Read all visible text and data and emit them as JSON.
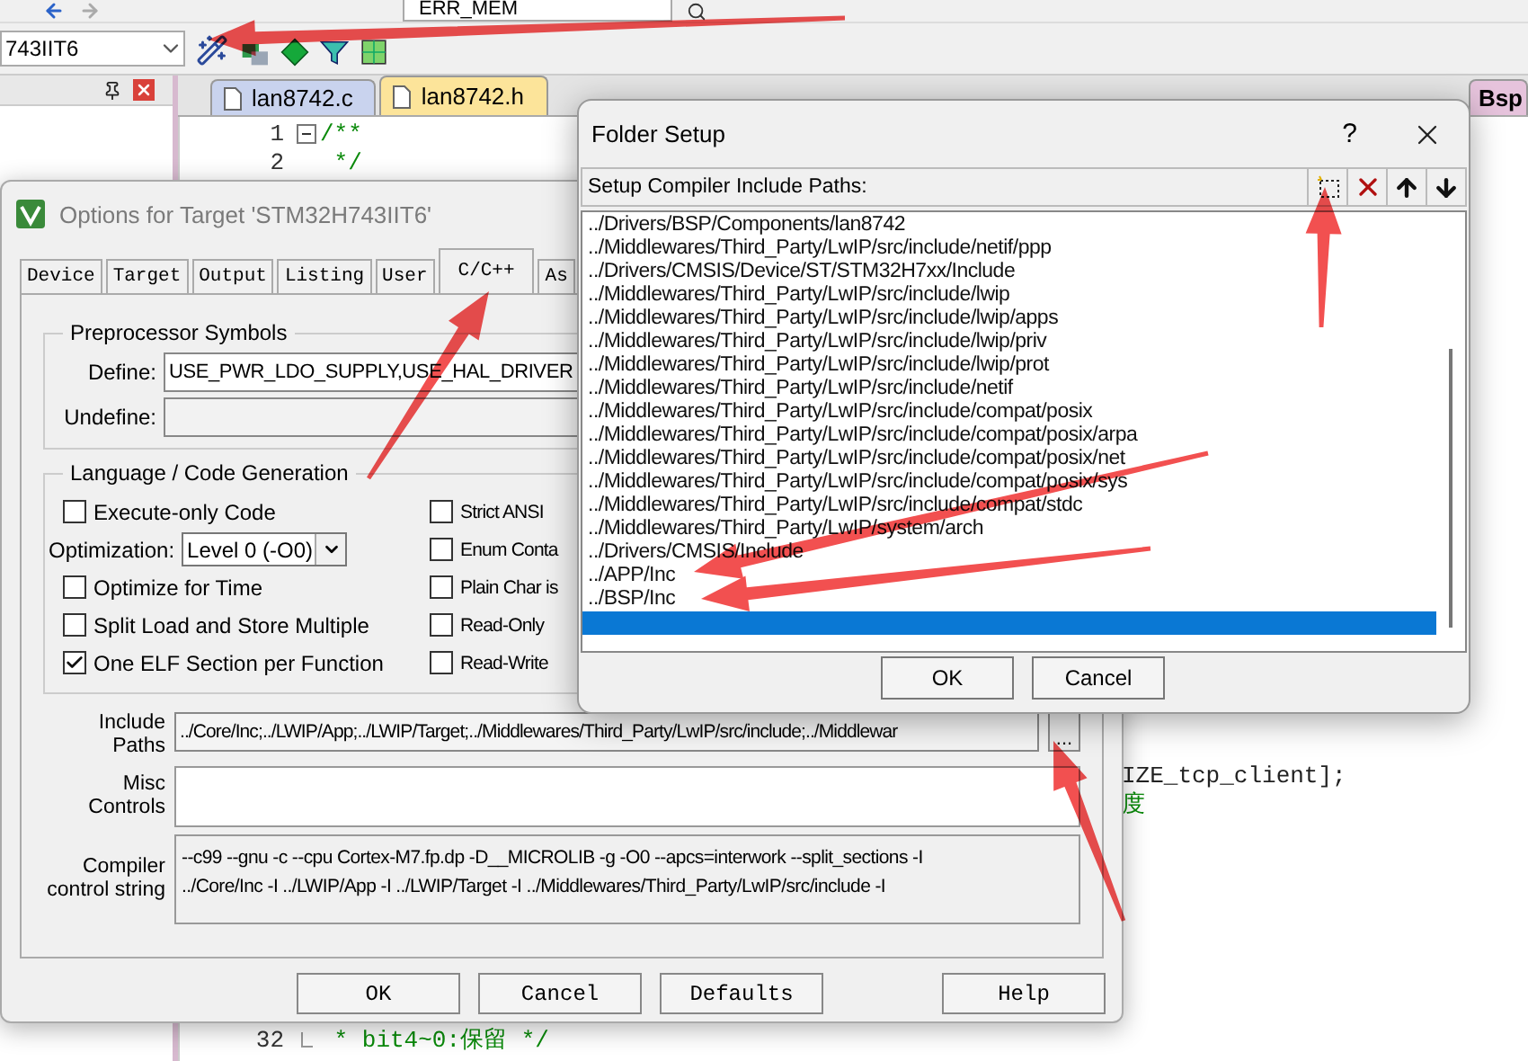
{
  "ide": {
    "find_combo": "ERR_MEM",
    "target_combo": "743IIT6",
    "editor_tabs": [
      {
        "label": "lan8742.c",
        "selected": false,
        "color": "#c9d3ee"
      },
      {
        "label": "lan8742.h",
        "selected": true,
        "color": "#fce49a"
      },
      {
        "label": "Bsp",
        "selected": false,
        "color": "#e6c3dc"
      }
    ],
    "editor_lines_top": [
      {
        "number": "1",
        "text": "/**",
        "fold_box": true,
        "kind": "comment"
      },
      {
        "number": "2",
        "text": " */",
        "kind": "comment"
      }
    ],
    "editor_fragments": [
      {
        "text": "IZE_tcp_client];",
        "kind": "code"
      },
      {
        "text": "度",
        "kind": "comment"
      }
    ],
    "editor_lines_bottom": [
      {
        "number": "32",
        "text": " * bit4~0:保留 */",
        "fold_end": true,
        "kind": "comment"
      }
    ]
  },
  "options_dialog": {
    "title": "Options for Target 'STM32H743IIT6'",
    "tabs": [
      {
        "label": "Device",
        "selected": false
      },
      {
        "label": "Target",
        "selected": false
      },
      {
        "label": "Output",
        "selected": false
      },
      {
        "label": "Listing",
        "selected": false
      },
      {
        "label": "User",
        "selected": false
      },
      {
        "label": "C/C++",
        "selected": true
      },
      {
        "label": "As",
        "selected": false
      }
    ],
    "preprocessor": {
      "title": "Preprocessor Symbols",
      "define_label": "Define:",
      "define_value": "USE_PWR_LDO_SUPPLY,USE_HAL_DRIVER",
      "undefine_label": "Undefine:"
    },
    "codegen": {
      "title": "Language / Code Generation",
      "left": [
        {
          "kind": "checkbox",
          "label": "Execute-only Code",
          "checked": false
        },
        {
          "kind": "select",
          "label": "Optimization:",
          "value": "Level 0 (-O0)"
        },
        {
          "kind": "checkbox",
          "label": "Optimize for Time",
          "checked": false
        },
        {
          "kind": "checkbox",
          "label": "Split Load and Store Multiple",
          "checked": false
        },
        {
          "kind": "checkbox",
          "label": "One ELF Section per Function",
          "checked": true
        }
      ],
      "right": [
        {
          "label": "Strict ANSI",
          "checked": false
        },
        {
          "label": "Enum Conta",
          "checked": false
        },
        {
          "label": "Plain Char is",
          "checked": false
        },
        {
          "label": "Read-Only",
          "checked": false
        },
        {
          "label": "Read-Write",
          "checked": false
        }
      ]
    },
    "include_paths": {
      "label": "Include Paths",
      "value": "../Core/Inc;../LWIP/App;../LWIP/Target;../Middlewares/Third_Party/LwIP/src/include;../Middlewar",
      "button": "..."
    },
    "misc_controls": {
      "label": "Misc Controls"
    },
    "compiler_string": {
      "label": "Compiler control string",
      "lines": [
        "--c99 --gnu -c --cpu Cortex-M7.fp.dp -D__MICROLIB -g -O0 --apcs=interwork --split_sections -I",
        "../Core/Inc -I ../LWIP/App -I ../LWIP/Target -I ../Middlewares/Third_Party/LwIP/src/include -I"
      ]
    },
    "buttons": [
      "OK",
      "Cancel",
      "Defaults",
      "Help"
    ]
  },
  "folder_dialog": {
    "title": "Folder Setup",
    "help": "?",
    "header": "Setup Compiler Include Paths:",
    "paths": [
      {
        "text": "../Drivers/BSP/Components/lan8742",
        "selected": false
      },
      {
        "text": "../Middlewares/Third_Party/LwIP/src/include/netif/ppp",
        "selected": false
      },
      {
        "text": "../Drivers/CMSIS/Device/ST/STM32H7xx/Include",
        "selected": false
      },
      {
        "text": "../Middlewares/Third_Party/LwIP/src/include/lwip",
        "selected": false
      },
      {
        "text": "../Middlewares/Third_Party/LwIP/src/include/lwip/apps",
        "selected": false
      },
      {
        "text": "../Middlewares/Third_Party/LwIP/src/include/lwip/priv",
        "selected": false
      },
      {
        "text": "../Middlewares/Third_Party/LwIP/src/include/lwip/prot",
        "selected": false
      },
      {
        "text": "../Middlewares/Third_Party/LwIP/src/include/netif",
        "selected": false
      },
      {
        "text": "../Middlewares/Third_Party/LwIP/src/include/compat/posix",
        "selected": false
      },
      {
        "text": "../Middlewares/Third_Party/LwIP/src/include/compat/posix/arpa",
        "selected": false
      },
      {
        "text": "../Middlewares/Third_Party/LwIP/src/include/compat/posix/net",
        "selected": false
      },
      {
        "text": "../Middlewares/Third_Party/LwIP/src/include/compat/posix/sys",
        "selected": false
      },
      {
        "text": "../Middlewares/Third_Party/LwIP/src/include/compat/stdc",
        "selected": false
      },
      {
        "text": "../Middlewares/Third_Party/LwIP/system/arch",
        "selected": false
      },
      {
        "text": "../Drivers/CMSIS/Include",
        "selected": false
      },
      {
        "text": "../APP/Inc",
        "selected": false
      },
      {
        "text": "../BSP/Inc",
        "selected": false
      },
      {
        "selected": true
      }
    ],
    "buttons": [
      "OK",
      "Cancel"
    ]
  }
}
